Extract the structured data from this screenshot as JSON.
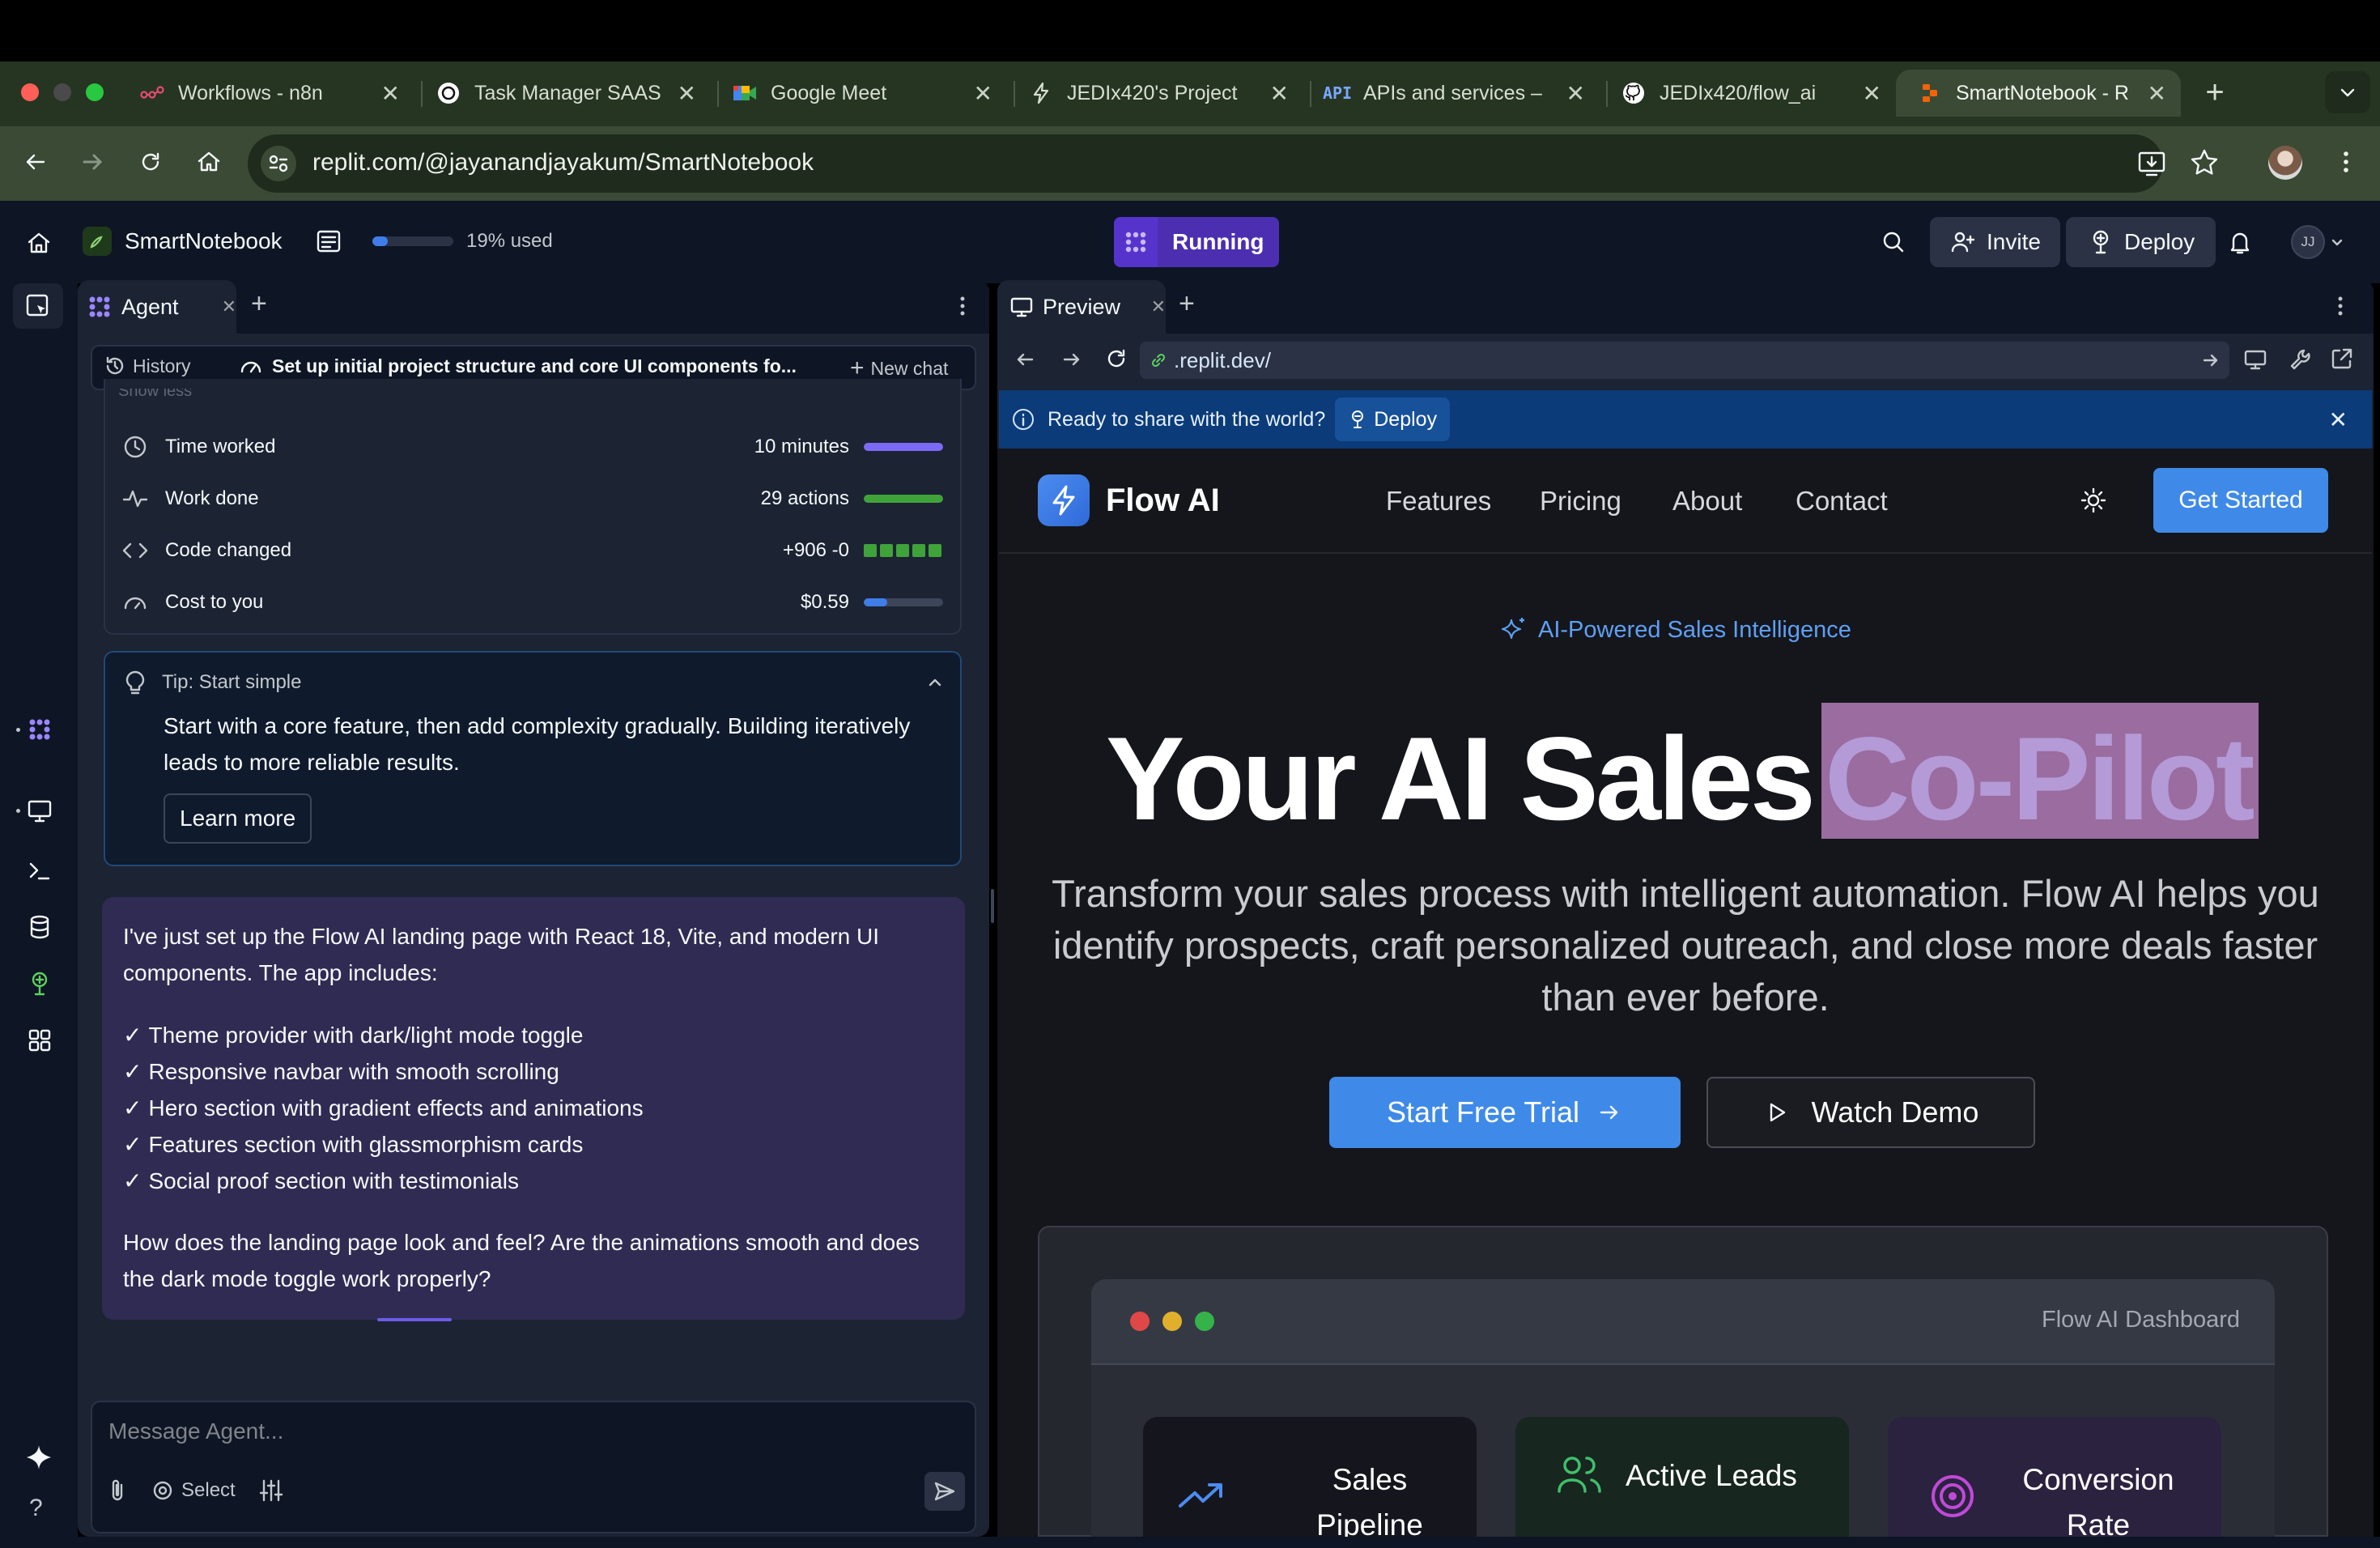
{
  "browser": {
    "tabs": [
      {
        "title": "Workflows - n8n",
        "icon": "n8n-icon"
      },
      {
        "title": "Task Manager SAAS",
        "icon": "openai-icon"
      },
      {
        "title": "Google Meet",
        "icon": "google-meet-icon"
      },
      {
        "title": "JEDIx420's Project",
        "icon": "bolt-icon"
      },
      {
        "title": "APIs and services –",
        "icon": "api-icon"
      },
      {
        "title": "JEDIx420/flow_ai",
        "icon": "github-icon"
      },
      {
        "title": "SmartNotebook - R",
        "icon": "replit-icon",
        "active": true
      }
    ],
    "url": "replit.com/@jayanandjayakum/SmartNotebook"
  },
  "replit": {
    "project_name": "SmartNotebook",
    "usage_label": "19% used",
    "usage_fraction": 0.19,
    "run_status": "Running",
    "invite_label": "Invite",
    "deploy_label": "Deploy",
    "avatar_initials": "JJ"
  },
  "agent": {
    "tab_label": "Agent",
    "history_label": "History",
    "chat_title": "Set up initial project structure and core UI components fo...",
    "new_chat_label": "New chat",
    "show_less": "Show less",
    "stats": [
      {
        "label": "Time worked",
        "value": "10 minutes",
        "color": "#7c6af6",
        "fill": 1.0
      },
      {
        "label": "Work done",
        "value": "29 actions",
        "color": "#3fa33a",
        "fill": 1.0
      },
      {
        "label": "Code changed",
        "value": "+906 -0"
      },
      {
        "label": "Cost to you",
        "value": "$0.59",
        "color": "#3f7de8",
        "fill": 0.3
      }
    ],
    "tip": {
      "title": "Tip: Start simple",
      "body": "Start with a core feature, then add complexity gradually. Building iteratively leads to more reliable results.",
      "button": "Learn more"
    },
    "message": {
      "intro": "I've just set up the Flow AI landing page with React 18, Vite, and modern UI components. The app includes:",
      "items": [
        "Theme provider with dark/light mode toggle",
        "Responsive navbar with smooth scrolling",
        "Hero section with gradient effects and animations",
        "Features section with glassmorphism cards",
        "Social proof section with testimonials"
      ],
      "question": "How does the landing page look and feel? Are the animations smooth and does the dark mode toggle work properly?"
    },
    "input_placeholder": "Message Agent...",
    "select_label": "Select"
  },
  "preview": {
    "tab_label": "Preview",
    "url": ".replit.dev/",
    "banner_text": "Ready to share with the world?",
    "banner_deploy": "Deploy"
  },
  "site": {
    "brand": "Flow AI",
    "nav": [
      "Features",
      "Pricing",
      "About",
      "Contact"
    ],
    "cta": "Get Started",
    "eyebrow": "AI-Powered Sales Intelligence",
    "headline_a": "Your AI Sales",
    "headline_b": "Co-Pilot",
    "subhead": "Transform your sales process with intelligent automation. Flow AI helps you identify prospects, craft personalized outreach, and close more deals faster than ever before.",
    "primary_button": "Start Free Trial",
    "secondary_button": "Watch Demo",
    "dashboard_title": "Flow AI Dashboard",
    "cards": [
      {
        "title": "Sales Pipeline",
        "icon": "trending-up-icon"
      },
      {
        "title": "Active Leads",
        "icon": "users-icon"
      },
      {
        "title": "Conversion Rate",
        "icon": "target-icon"
      }
    ]
  }
}
